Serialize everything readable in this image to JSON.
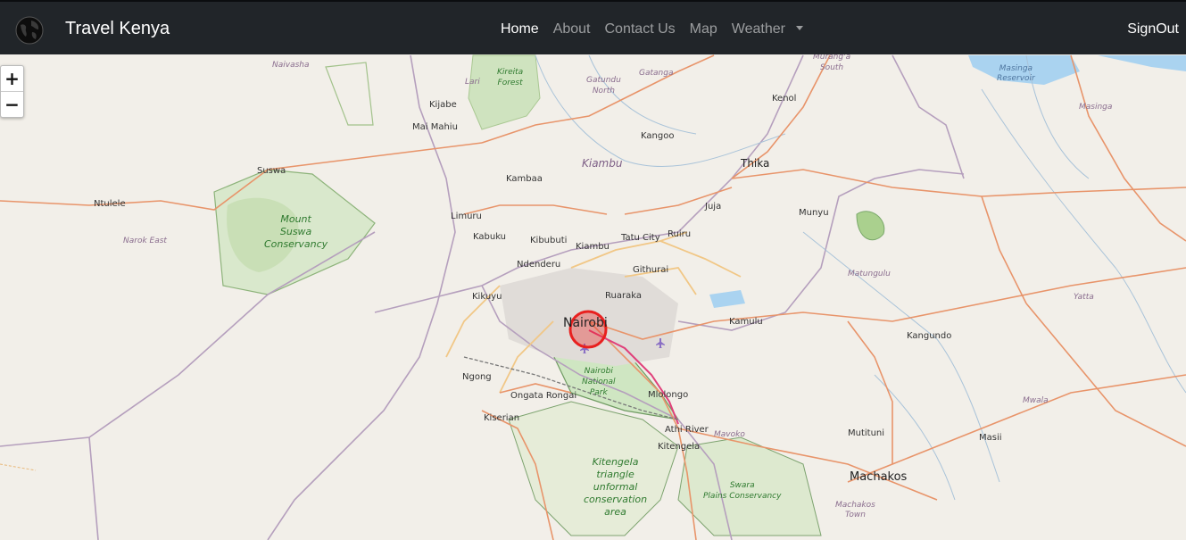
{
  "navbar": {
    "brand": "Travel Kenya",
    "links": [
      "Home",
      "About",
      "Contact Us",
      "Map",
      "Weather"
    ],
    "signout": "SignOut"
  },
  "map": {
    "zoom_in": "+",
    "zoom_out": "−",
    "labels": {
      "naivasha": "Naivasha",
      "lari": "Lari",
      "kireita": "Kireita\nForest",
      "gatanga": "Gatanga",
      "gatundu": "Gatundu\nNorth",
      "murang": "Murang'a\nSouth",
      "masinga_res": "Masinga\nReservoir",
      "kijabe": "Kijabe",
      "maimahiu": "Mai Mahiu",
      "kenol": "Kenol",
      "masinga": "Masinga",
      "kangoo": "Kangoo",
      "kiambu_county": "Kiambu",
      "thika": "Thika",
      "suswa": "Suswa",
      "kambaa": "Kambaa",
      "ntulele": "Ntulele",
      "juja": "Juja",
      "munyu": "Munyu",
      "mount_suswa": "Mount\nSuswa\nConservancy",
      "limuru": "Limuru",
      "kabuku": "Kabuku",
      "kibubuti": "Kibubuti",
      "tatu_city": "Tatu City",
      "ruiru": "Ruiru",
      "narok_east": "Narok East",
      "kiambu": "Kiambu",
      "ndenderu": "Ndenderu",
      "githurai": "Githurai",
      "matungulu": "Matungulu",
      "kikuyu": "Kikuyu",
      "ruaraka": "Ruaraka",
      "yatta": "Yatta",
      "nairobi": "Nairobi",
      "kamulu": "Kamulu",
      "kangundo": "Kangundo",
      "ngong": "Ngong",
      "nnp": "Nairobi\nNational\nPark",
      "ongata": "Ongata Rongai",
      "mlolongo": "Mlolongo",
      "mwala": "Mwala",
      "kiserian": "Kiserian",
      "athi_river": "Athi River",
      "mavoko": "Mavoko",
      "mutituni": "Mutituni",
      "masii": "Masii",
      "kitengela": "Kitengela",
      "kitengela_area": "Kitengela\ntriangle\nunformal\nconservation\narea",
      "swara": "Swara\nPlains Conservancy",
      "machakos": "Machakos",
      "machakos_town": "Machakos\nTown"
    }
  },
  "colors": {
    "navbar_bg": "#212529",
    "map_bg": "#f2efe9",
    "marker": "#e8201f",
    "road_primary": "#e8926b",
    "road_secondary": "#f3c98b",
    "boundary": "#9b7fa3",
    "water": "#9ccff0",
    "park": "#cfe6c2"
  }
}
